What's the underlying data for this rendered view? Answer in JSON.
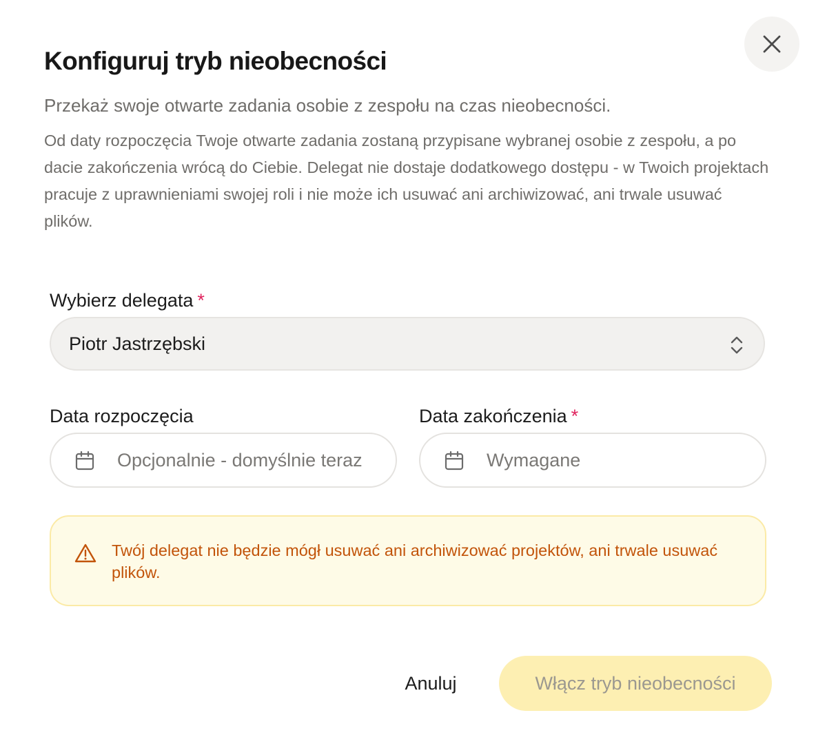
{
  "dialog": {
    "title": "Konfiguruj tryb nieobecności",
    "subtitle": "Przekaż swoje otwarte zadania osobie z zespołu na czas nieobecności.",
    "description": "Od daty rozpoczęcia Twoje otwarte zadania zostaną przypisane wybranej osobie z zespołu, a po dacie zakończenia wrócą do Ciebie. Delegat nie dostaje dodatkowego dostępu - w Twoich projektach pracuje z uprawnieniami swojej roli i nie może ich usuwać ani archiwizować, ani trwale usuwać plików.",
    "close_icon": "close-icon"
  },
  "delegate": {
    "label": "Wybierz delegata",
    "required_mark": "*",
    "selected_value": "Piotr Jastrzębski",
    "chevron_icon": "chevron-up-down-icon"
  },
  "start_date": {
    "label": "Data rozpoczęcia",
    "value": "",
    "placeholder": "Opcjonalnie - domyślnie teraz",
    "icon": "calendar-icon"
  },
  "end_date": {
    "label": "Data zakończenia",
    "required_mark": "*",
    "value": "",
    "placeholder": "Wymagane",
    "icon": "calendar-icon"
  },
  "warning": {
    "icon": "warning-triangle-icon",
    "text": "Twój delegat nie będzie mógł usuwać ani archiwizować projektów, ani trwale usuwać plików."
  },
  "actions": {
    "cancel_label": "Anuluj",
    "submit_label": "Włącz tryb nieobecności"
  },
  "colors": {
    "required": "#e0245e",
    "warning_text": "#c2540a",
    "warning_bg": "#fefbe7",
    "submit_bg": "#fdefb2"
  }
}
